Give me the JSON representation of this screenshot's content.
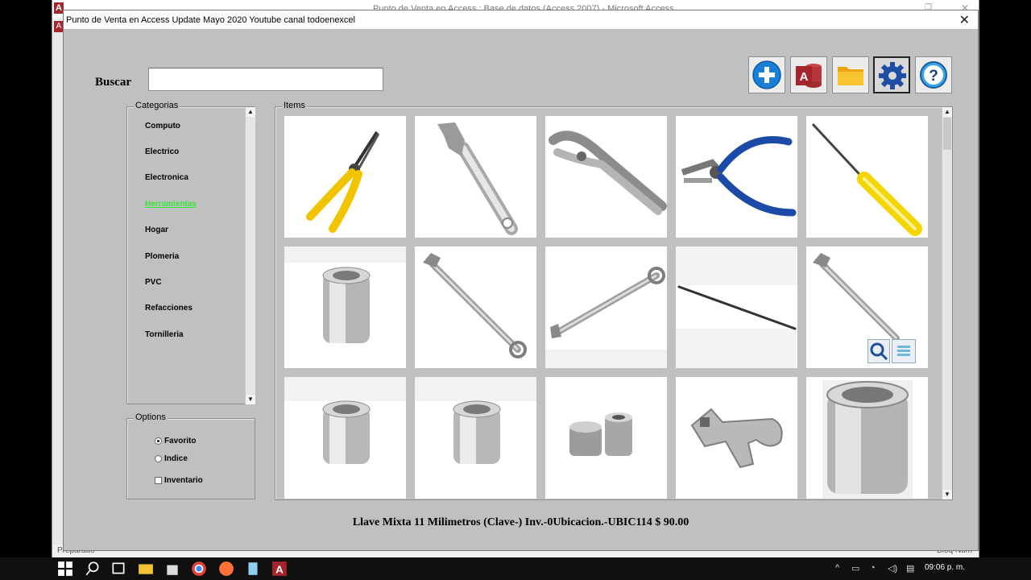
{
  "background_window": {
    "title": "Punto de Venta en Access : Base de datos (Access 2007) - Microsoft Access",
    "status_left": "Preparado",
    "status_right": "Bloq Num"
  },
  "form": {
    "title": "Punto de Venta en Access Update Mayo 2020 Youtube canal todoenexcel",
    "close_glyph": "✕"
  },
  "search": {
    "label": "Buscar",
    "value": ""
  },
  "toolbar": {
    "buttons": [
      {
        "name": "add",
        "icon": "plus-circle-icon"
      },
      {
        "name": "access",
        "icon": "access-db-icon"
      },
      {
        "name": "folder",
        "icon": "folder-icon"
      },
      {
        "name": "settings",
        "icon": "gear-icon"
      },
      {
        "name": "help",
        "icon": "question-icon"
      }
    ]
  },
  "categorias": {
    "label": "Categorias",
    "items": [
      "Computo",
      "Electrico",
      "Electronica",
      "Herramientas",
      "Hogar",
      "Plomeria",
      "PVC",
      "Refacciones",
      "Tornilleria"
    ],
    "selected": "Herramientas"
  },
  "options": {
    "label": "Options",
    "favorito": "Favorito",
    "indice": "Indice",
    "inventario": "Inventario",
    "selected": "Favorito",
    "inventario_checked": false
  },
  "items": {
    "label": "Items",
    "tiles": [
      {
        "icon": "needle-nose-pliers-icon"
      },
      {
        "icon": "adjustable-wrench-icon"
      },
      {
        "icon": "locking-pliers-icon"
      },
      {
        "icon": "diagonal-cutters-icon"
      },
      {
        "icon": "screwdriver-icon"
      },
      {
        "icon": "socket-icon"
      },
      {
        "icon": "combination-wrench-icon"
      },
      {
        "icon": "combination-wrench-icon"
      },
      {
        "icon": "file-rod-icon"
      },
      {
        "icon": "combination-wrench-icon"
      },
      {
        "icon": "socket-icon"
      },
      {
        "icon": "socket-icon"
      },
      {
        "icon": "socket-set-icon"
      },
      {
        "icon": "crowfoot-wrench-icon"
      },
      {
        "icon": "large-socket-icon"
      }
    ]
  },
  "status_line": "Llave Mixta 11 Milimetros (Clave-) Inv.-0Ubicacion.-UBIC114 $ 90.00",
  "taskbar": {
    "time": "09:06 p. m."
  },
  "colors": {
    "form_bg": "#c0c0c0",
    "selected_category": "#37e537",
    "accent_blue": "#1d6fd0"
  }
}
